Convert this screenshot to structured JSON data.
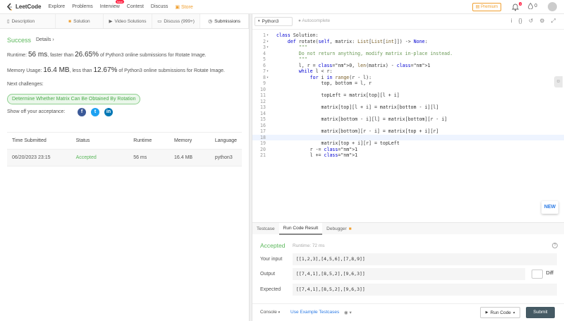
{
  "nav": {
    "logo": "LeetCode",
    "items": [
      "Explore",
      "Problems",
      "Interview",
      "Contest",
      "Discuss"
    ],
    "interview_badge": "New",
    "store": "Store",
    "premium": "Premium",
    "notif_count": "3",
    "points": "0"
  },
  "left_tabs": [
    {
      "label": "Description",
      "icon": "description-icon"
    },
    {
      "label": "Solution",
      "icon": "lock-icon"
    },
    {
      "label": "Video Solutions",
      "icon": "video-icon"
    },
    {
      "label": "Discuss (999+)",
      "icon": "discuss-icon"
    },
    {
      "label": "Submissions",
      "icon": "clock-icon"
    }
  ],
  "result": {
    "status": "Success",
    "details_link": "Details",
    "runtime": {
      "label": "Runtime:",
      "value": "56 ms",
      "mid": ", faster than",
      "pct": "26.65%",
      "tail": "of Python3 online submissions for Rotate Image."
    },
    "memory": {
      "label": "Memory Usage:",
      "value": "16.4 MB",
      "mid": ", less than",
      "pct": "12.67%",
      "tail": "of Python3 online submissions for Rotate Image."
    },
    "next_label": "Next challenges:",
    "next_challenge": "Determine Whether Matrix Can Be Obtained By Rotation",
    "show_off": "Show off your acceptance:",
    "social": [
      "facebook-icon",
      "twitter-icon",
      "linkedin-icon"
    ]
  },
  "submissions": {
    "headers": [
      "Time Submitted",
      "Status",
      "Runtime",
      "Memory",
      "Language"
    ],
    "rows": [
      [
        "06/20/2023 23:15",
        "Accepted",
        "56 ms",
        "16.4 MB",
        "python3"
      ]
    ]
  },
  "editor": {
    "language": "Python3",
    "autocomplete": "Autocomplete",
    "toolbar_icons": [
      "info-icon",
      "braces-icon",
      "reset-icon",
      "settings-icon",
      "fullscreen-icon"
    ],
    "current_line": 18,
    "lines": [
      "class Solution:",
      "    def rotate(self, matrix: List[List[int]]) -> None:",
      "        \"\"\"",
      "        Do not return anything, modify matrix in-place instead.",
      "        \"\"\"",
      "        l, r = 0, len(matrix) - 1",
      "        while l < r:",
      "            for i in range(r - l):",
      "                top, bottom = l, r",
      "",
      "                topLeft = matrix[top][l + i]",
      "",
      "                matrix[top][l + i] = matrix[bottom - i][l]",
      "",
      "                matrix[bottom - i][l] = matrix[bottom][r - i]",
      "",
      "                matrix[bottom][r - i] = matrix[top + i][r]",
      "",
      "                matrix[top + i][r] = topLeft",
      "            r -= 1",
      "            l += 1"
    ],
    "fold_lines": [
      1,
      2,
      3,
      7,
      8
    ],
    "new_badge": "NEW"
  },
  "bottom": {
    "tabs": [
      "Testcase",
      "Run Code Result",
      "Debugger"
    ],
    "status": "Accepted",
    "runtime": "Runtime: 72 ms",
    "your_input_label": "Your input",
    "your_input": "[[1,2,3],[4,5,6],[7,8,9]]",
    "output_label": "Output",
    "output": "[[7,4,1],[8,5,2],[9,6,3]]",
    "diff_label": "Diff",
    "expected_label": "Expected",
    "expected": "[[7,4,1],[8,5,2],[9,6,3]]"
  },
  "footer": {
    "console": "Console",
    "use_example": "Use Example Testcases",
    "run_code": "Run Code",
    "submit": "Submit"
  }
}
